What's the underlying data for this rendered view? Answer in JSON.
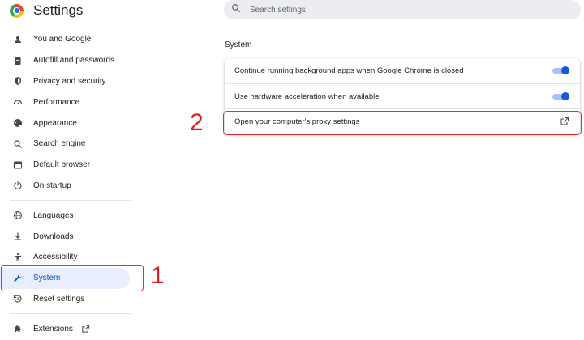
{
  "app": {
    "title": "Settings"
  },
  "search": {
    "placeholder": "Search settings"
  },
  "sidebar": {
    "items": [
      {
        "label": "You and Google",
        "icon": "person-icon"
      },
      {
        "label": "Autofill and passwords",
        "icon": "clipboard-icon"
      },
      {
        "label": "Privacy and security",
        "icon": "shield-icon"
      },
      {
        "label": "Performance",
        "icon": "speedometer-icon"
      },
      {
        "label": "Appearance",
        "icon": "palette-icon"
      },
      {
        "label": "Search engine",
        "icon": "search-icon"
      },
      {
        "label": "Default browser",
        "icon": "browser-icon"
      },
      {
        "label": "On startup",
        "icon": "power-icon"
      },
      {
        "label": "Languages",
        "icon": "globe-icon"
      },
      {
        "label": "Downloads",
        "icon": "download-icon"
      },
      {
        "label": "Accessibility",
        "icon": "accessibility-icon"
      },
      {
        "label": "System",
        "icon": "wrench-icon",
        "active": true
      },
      {
        "label": "Reset settings",
        "icon": "history-icon"
      },
      {
        "label": "Extensions",
        "icon": "puzzle-icon"
      }
    ]
  },
  "main": {
    "section_title": "System",
    "rows": [
      {
        "label": "Continue running background apps when Google Chrome is closed",
        "control": "toggle",
        "on": true
      },
      {
        "label": "Use hardware acceleration when available",
        "control": "toggle",
        "on": true
      },
      {
        "label": "Open your computer's proxy settings",
        "control": "external-link"
      }
    ]
  },
  "annotations": {
    "step1": "1",
    "step2": "2"
  },
  "colors": {
    "accent": "#1a56d8",
    "active_bg": "#e8eefc",
    "annotation": "#e03131"
  }
}
